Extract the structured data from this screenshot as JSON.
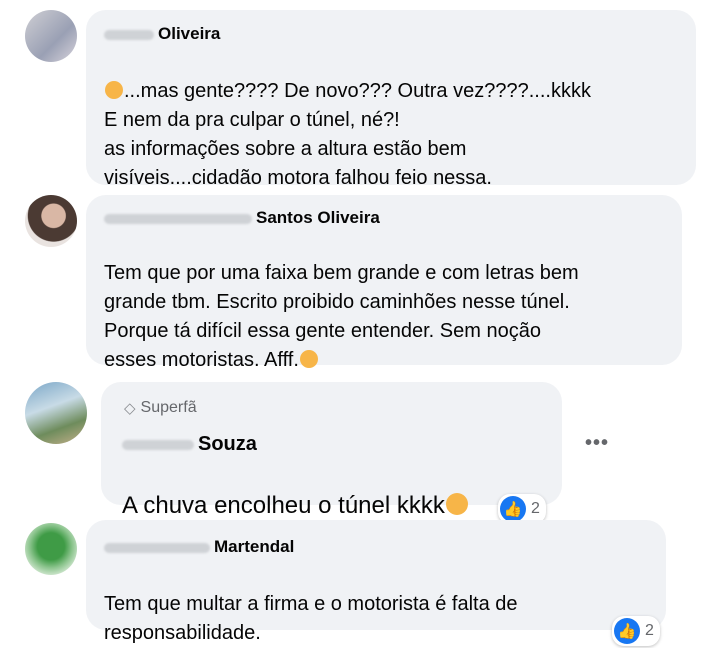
{
  "comments": [
    {
      "name": "Oliveira",
      "text": "...mas gente???? De novo??? Outra vez????....kkkk\nE nem da pra culpar o túnel, né?!\nas informações sobre a altura estão bem\nvisíveis....cidadão motora falhou feio nessa."
    },
    {
      "name": "Santos Oliveira",
      "text": "Tem que por uma faixa bem grande e com letras bem\ngrande tbm. Escrito proibido caminhões nesse túnel.\nPorque tá difícil essa gente entender. Sem noção\nesses motoristas. Afff."
    },
    {
      "badge": "Superfã",
      "name": "Souza",
      "text": "A chuva encolheu o túnel kkkk",
      "reaction_count": "2"
    },
    {
      "name": "Martendal",
      "text": "Tem que multar a firma e o motorista é falta de\nresponsabilidade.",
      "reaction_count": "2"
    }
  ],
  "more_options": "•••",
  "like_icon": "👍"
}
